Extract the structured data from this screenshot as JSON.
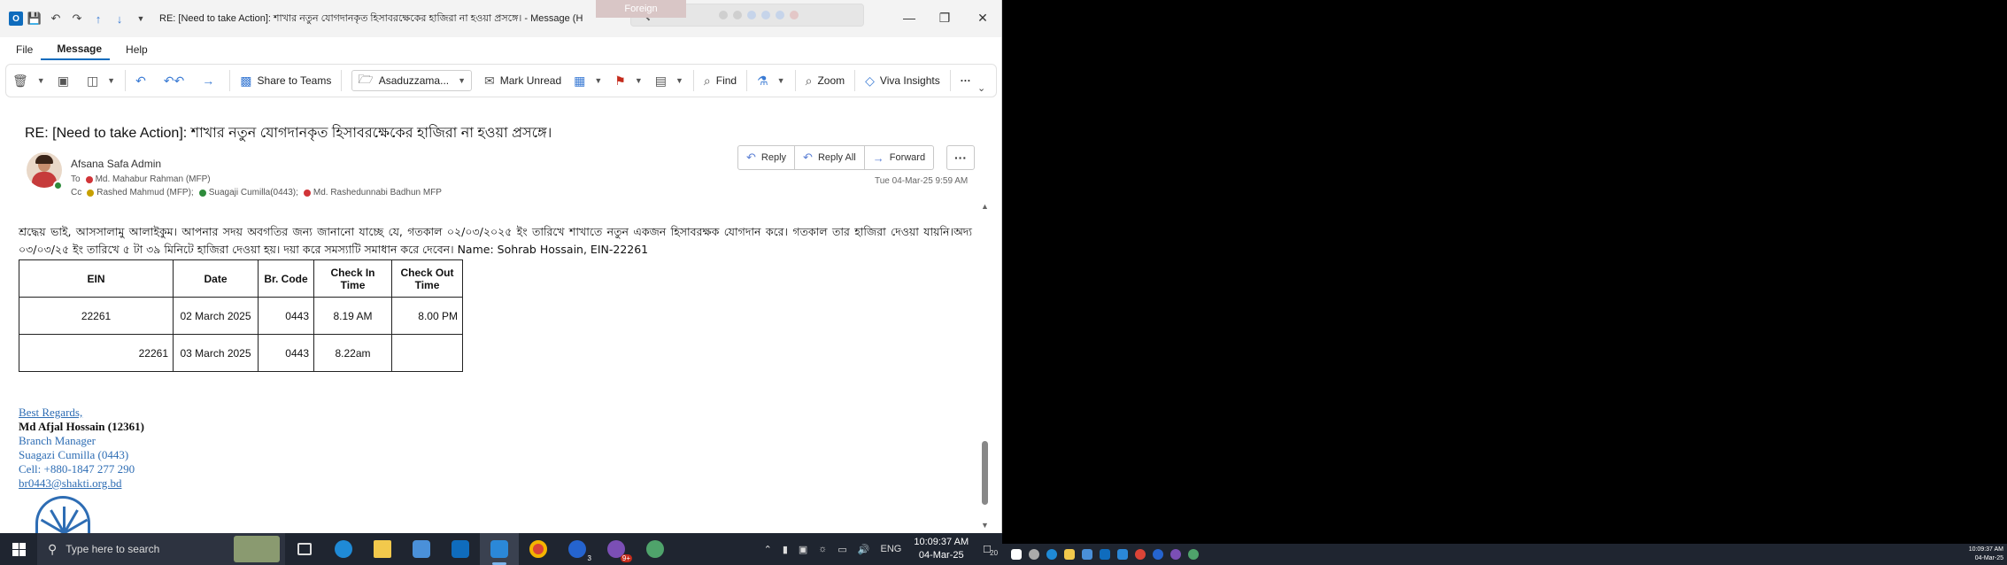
{
  "window": {
    "title": "RE: [Need to take Action]: শাখার নতুন  যোগদানকৃত হিসাবরক্ষেকের হাজিরা না হওয়া প্রসঙ্গে। - Message (H",
    "search_placeholder": "Search",
    "tooltip": "Foreign"
  },
  "menu": [
    "File",
    "Message",
    "Help"
  ],
  "ribbon": {
    "share_teams": "Share to Teams",
    "move_to": "Asaduzzama...",
    "mark_unread": "Mark Unread",
    "find": "Find",
    "zoom": "Zoom",
    "viva": "Viva Insights",
    "more": "···"
  },
  "email": {
    "subject": "RE: [Need to take Action]: শাখার নতুন  যোগদানকৃত হিসাবরক্ষেকের হাজিরা না হওয়া প্রসঙ্গে।",
    "from": "Afsana Safa Admin",
    "to_label": "To",
    "to": "Md. Mahabur Rahman (MFP)",
    "cc_label": "Cc",
    "cc": [
      "Rashed Mahmud (MFP);",
      "Suagaji Cumilla(0443);",
      "Md. Rashedunnabi Badhun MFP"
    ],
    "date": "Tue 04-Mar-25 9:59 AM",
    "actions": {
      "reply": "Reply",
      "reply_all": "Reply All",
      "forward": "Forward",
      "more": "···"
    },
    "body": "শ্রদ্ধেয় ভাই, আসসালামু আলাইকুম। আপনার সদয় অবগতির জন্য জানানো যাচ্ছে যে, গতকাল ০২/০৩/২০২৫ ইং তারিখে শাখাতে নতুন একজন হিসাবরক্ষক যোগদান করে। গতকাল তার হাজিরা দেওয়া যায়নি।অদ্য ০৩/০৩/২৫ ইং তারিখে ৫ টা ৩৯ মিনিটে হাজিরা দেওয়া হয়। দয়া করে সমস্যাটি সমাধান  করে দেবেন। Name: Sohrab Hossain, EIN-22261"
  },
  "table": {
    "headers": [
      "EIN",
      "Date",
      "Br. Code",
      "Check In Time",
      "Check Out Time"
    ],
    "rows": [
      [
        "22261",
        "02 March 2025",
        "0443",
        "8.19 AM",
        "8.00 PM"
      ],
      [
        "22261",
        "03 March 2025",
        "0443",
        "8.22am",
        ""
      ]
    ]
  },
  "signature": {
    "regards": "Best Regards,",
    "name": "Md Afjal Hossain (12361)",
    "title": "Branch Manager",
    "branch": "Suagazi Cumilla (0443)",
    "cell": "Cell: +880-1847 277 290",
    "email": "br0443@shakti.org.bd"
  },
  "taskbar": {
    "search_placeholder": "Type here to search",
    "lang": "ENG",
    "time": "10:09:37 AM",
    "date": "04-Mar-25",
    "notif": "20",
    "badge_todo": "3",
    "badge_app": "9+"
  },
  "taskbar2": {
    "time": "10:09:37 AM",
    "date": "04-Mar-25"
  },
  "colors": {
    "accent": "#0f6cbd",
    "taskbar": "#1f2530",
    "signature": "#2e6db4"
  }
}
